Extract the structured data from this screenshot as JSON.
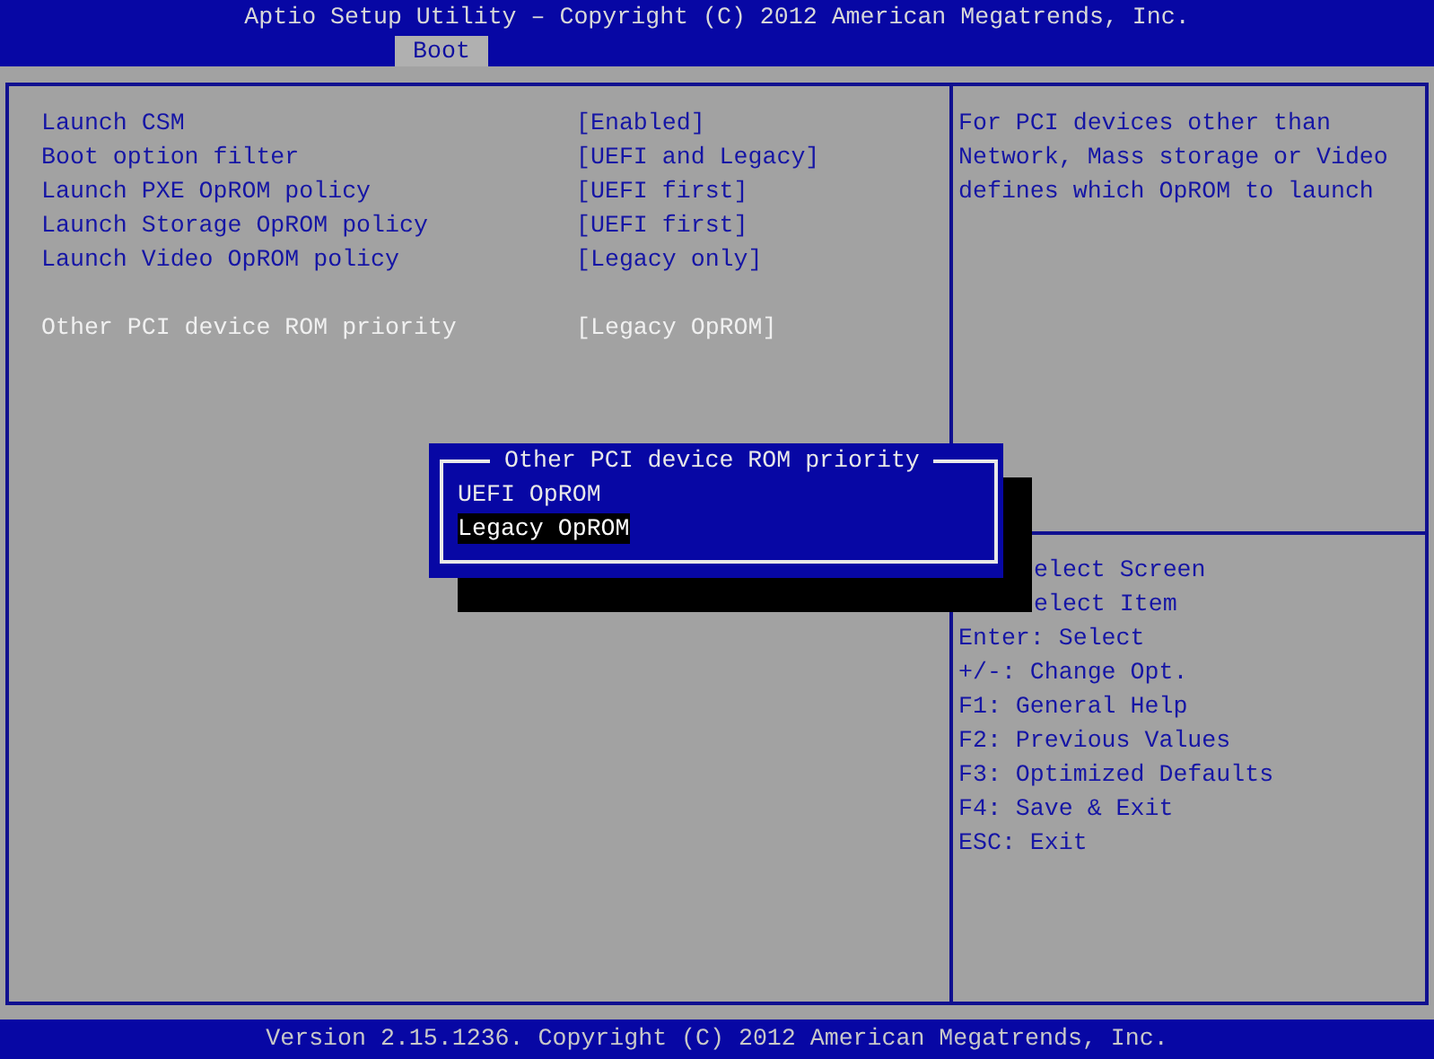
{
  "header": {
    "title": "Aptio Setup Utility – Copyright (C) 2012 American Megatrends, Inc.",
    "tabs": [
      {
        "label": "Boot",
        "selected": true
      }
    ]
  },
  "setting_groups": [
    [
      {
        "label": "Launch CSM",
        "value": "[Enabled]",
        "selected": false
      },
      {
        "label": "Boot option filter",
        "value": "[UEFI and Legacy]",
        "selected": false
      },
      {
        "label": "Launch PXE OpROM policy",
        "value": "[UEFI first]",
        "selected": false
      },
      {
        "label": "Launch Storage OpROM policy",
        "value": "[UEFI first]",
        "selected": false
      },
      {
        "label": "Launch Video OpROM policy",
        "value": "[Legacy only]",
        "selected": false
      }
    ],
    [
      {
        "label": "Other PCI device ROM priority",
        "value": "[Legacy OpROM]",
        "selected": true
      }
    ]
  ],
  "description": [
    "For PCI devices other than",
    "Network, Mass storage or Video",
    "defines which OpROM to launch"
  ],
  "help_partly_hidden": [
    "elect Screen",
    "elect Item"
  ],
  "help": [
    "Enter: Select",
    "+/-: Change Opt.",
    "F1: General Help",
    "F2: Previous Values",
    "F3: Optimized Defaults",
    "F4: Save & Exit",
    "ESC: Exit"
  ],
  "popup": {
    "title": "Other PCI device ROM priority",
    "options": [
      {
        "label": "UEFI OpROM",
        "selected": false
      },
      {
        "label": "Legacy OpROM",
        "selected": true
      }
    ]
  },
  "footer": "Version 2.15.1236. Copyright (C) 2012 American Megatrends, Inc."
}
